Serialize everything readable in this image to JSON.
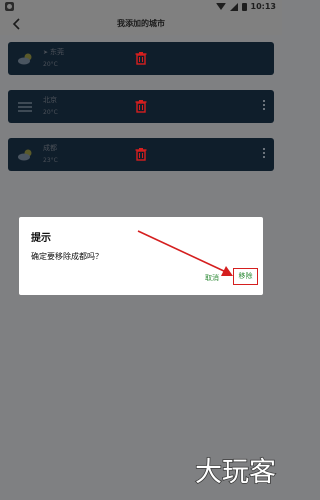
{
  "status_bar": {
    "time": "10:13"
  },
  "header": {
    "title": "我添加的城市"
  },
  "cities": [
    {
      "name": "东莞",
      "temp": "20°C",
      "icon": "cloud-sun-icon",
      "located": true
    },
    {
      "name": "北京",
      "temp": "20°C",
      "icon": "haze-icon",
      "located": false
    },
    {
      "name": "成都",
      "temp": "23°C",
      "icon": "cloud-sun-icon",
      "located": false
    }
  ],
  "dialog": {
    "title": "提示",
    "message": "确定要移除成都吗？",
    "cancel_label": "取消",
    "remove_label": "移除"
  },
  "watermark": {
    "text": "大玩客"
  },
  "colors": {
    "accent": "#2e8b37",
    "danger": "#d51f1f",
    "card": "#0f1e2b"
  }
}
